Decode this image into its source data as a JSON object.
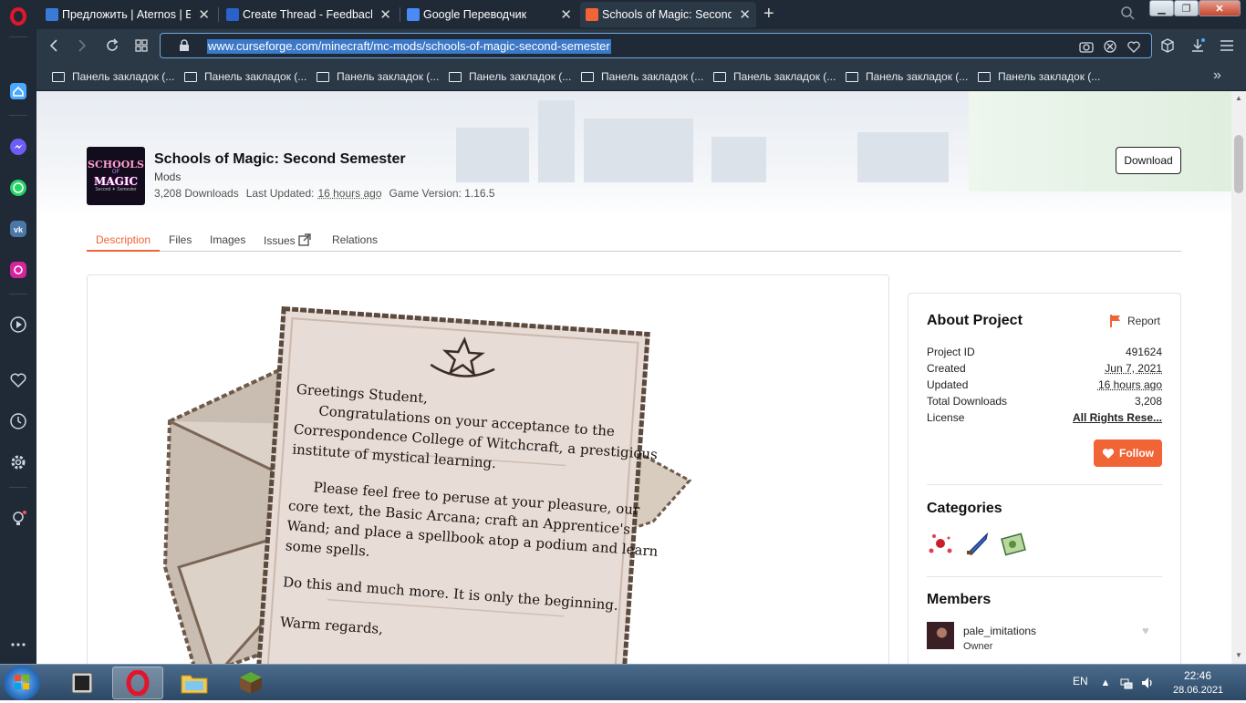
{
  "browser": {
    "tabs": [
      {
        "title": "Предложить | Aternos | Бе",
        "favicon_color": "#3b7bd8"
      },
      {
        "title": "Create Thread - Feedback/",
        "favicon_color": "#2a62c9"
      },
      {
        "title": "Google Переводчик",
        "favicon_color": "#4a8af4"
      },
      {
        "title": "Schools of Magic: Second S",
        "favicon_color": "#f16436"
      }
    ],
    "url": "www.curseforge.com/minecraft/mc-mods/schools-of-magic-second-semester",
    "bookmarks": [
      "Панель закладок (...",
      "Панель закладок (...",
      "Панель закладок (...",
      "Панель закладок (...",
      "Панель закладок (...",
      "Панель закладок (...",
      "Панель закладок (...",
      "Панель закладок (..."
    ]
  },
  "project": {
    "logo_lines": [
      "SCHOOLS",
      "OF",
      "MAGIC",
      "Second ✦ Semester"
    ],
    "title": "Schools of Magic: Second Semester",
    "class": "Mods",
    "downloads": "3,208 Downloads",
    "last_updated_label": "Last Updated:",
    "last_updated_value": "16 hours ago",
    "game_version": "Game Version: 1.16.5",
    "download_label": "Download"
  },
  "tabs": [
    "Description",
    "Files",
    "Images",
    "Issues",
    "Relations"
  ],
  "letter": {
    "lines": [
      "Greetings Student,",
      "Congratulations on your acceptance to the",
      "Correspondence College of Witchcraft, a prestigious",
      "institute of mystical learning.",
      "Please feel free to peruse at your pleasure, our",
      "core text, the Basic Arcana; craft an Apprentice's",
      "Wand; and place a spellbook atop a podium and learn",
      "some spells.",
      "Do this and much more. It is only the beginning.",
      "Warm regards,"
    ]
  },
  "about": {
    "title": "About Project",
    "report_label": "Report",
    "rows": [
      {
        "k": "Project ID",
        "v": "491624"
      },
      {
        "k": "Created",
        "v": "Jun 7, 2021"
      },
      {
        "k": "Updated",
        "v": "16 hours ago"
      },
      {
        "k": "Total Downloads",
        "v": "3,208"
      },
      {
        "k": "License",
        "v": "All Rights Rese..."
      }
    ],
    "follow_label": "Follow",
    "categories_title": "Categories",
    "members_title": "Members",
    "member_name": "pale_imitations",
    "member_role": "Owner"
  },
  "colors": {
    "accent": "#f16436",
    "browser_dark": "#1f2a36",
    "url_highlight": "#3b78c8"
  },
  "taskbar": {
    "lang": "EN",
    "time": "22:46",
    "date": "28.06.2021"
  }
}
